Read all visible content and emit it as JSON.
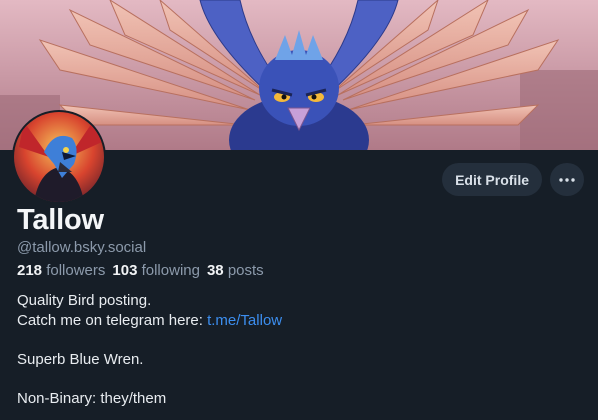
{
  "profile": {
    "display_name": "Tallow",
    "handle": "@tallow.bsky.social",
    "avatar_icon": "bird-avatar-icon",
    "banner_icon": "winged-bird-banner"
  },
  "actions": {
    "edit_label": "Edit Profile",
    "more_icon": "ellipsis-icon"
  },
  "stats": {
    "followers_count": "218",
    "followers_label": "followers",
    "following_count": "103",
    "following_label": "following",
    "posts_count": "38",
    "posts_label": "posts"
  },
  "bio": {
    "line1": "Quality Bird posting.",
    "line2_prefix": "Catch me on telegram here: ",
    "line2_link": "t.me/Tallow",
    "line3": "Superb Blue Wren.",
    "line4": "Non-Binary: they/them"
  },
  "colors": {
    "background": "#161e27",
    "link": "#3c8eef",
    "muted": "#8c9aab",
    "button_bg": "#242f3c"
  }
}
